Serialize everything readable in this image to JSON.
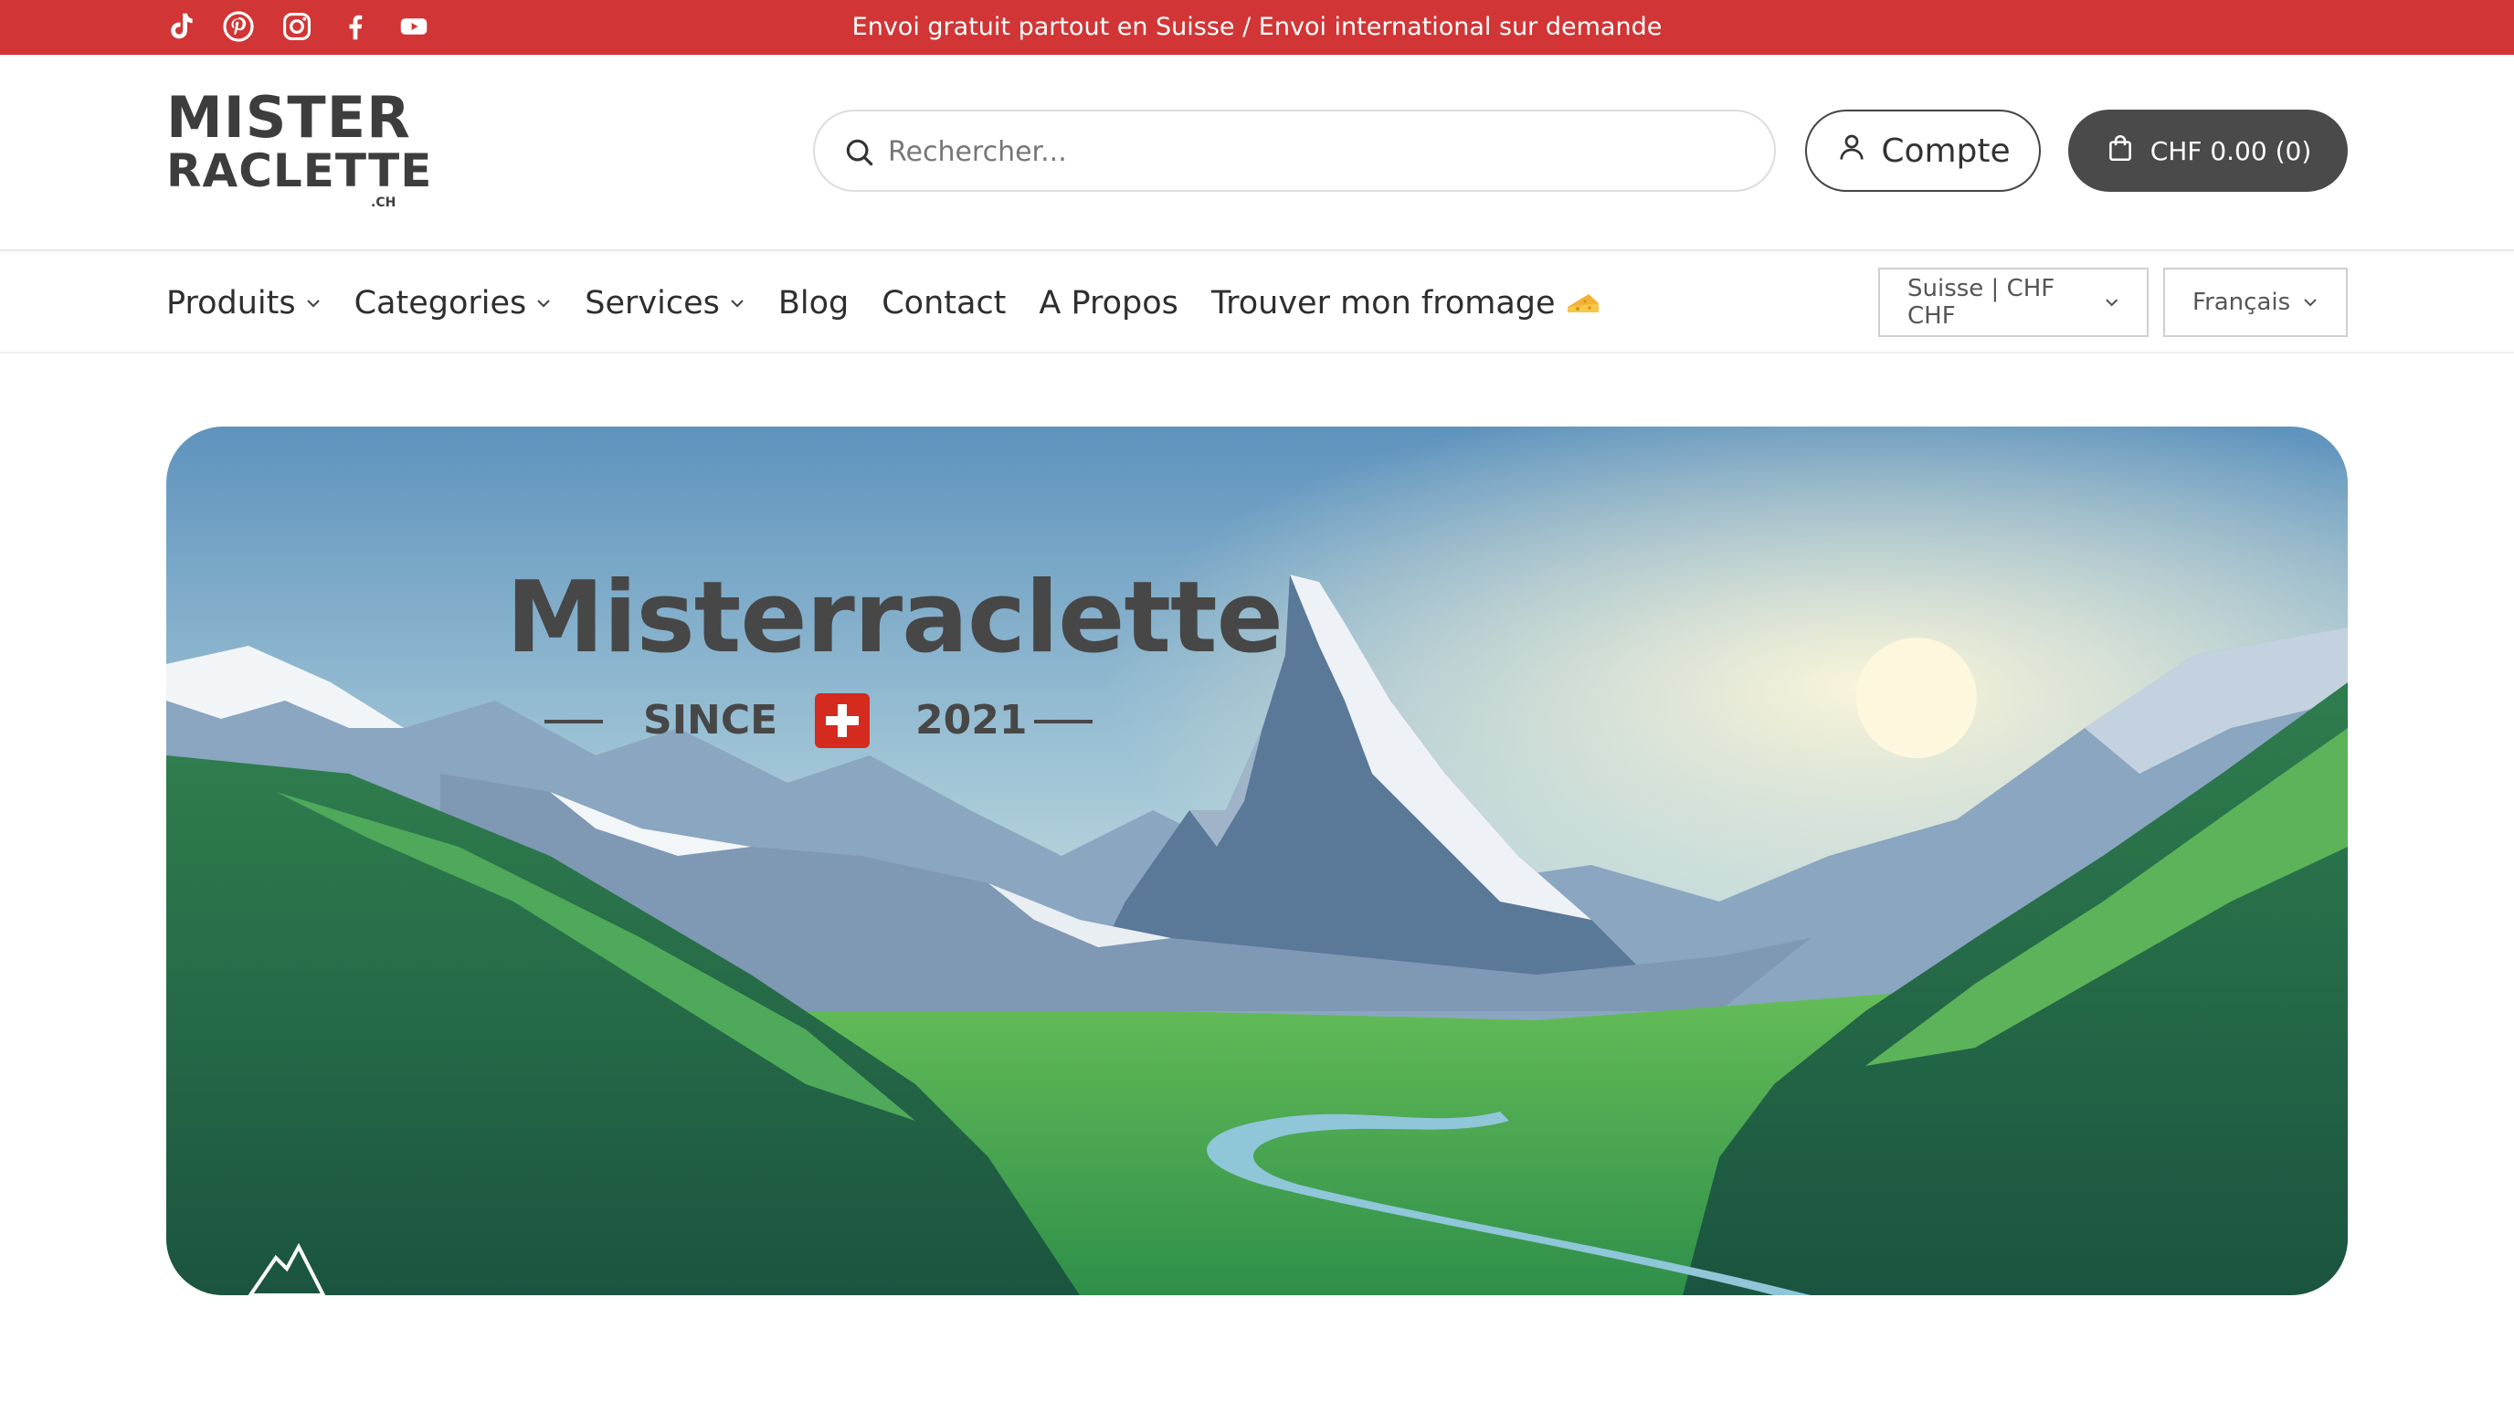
{
  "topbar": {
    "announcement": "Envoi gratuit partout en Suisse / Envoi international sur demande",
    "social": [
      "tiktok-icon",
      "pinterest-icon",
      "instagram-icon",
      "facebook-icon",
      "youtube-icon"
    ],
    "color": "#d13535"
  },
  "header": {
    "logo": {
      "line1": "MISTER",
      "line2": "RACLETTE",
      "suffix": ".CH"
    },
    "search": {
      "placeholder": "Rechercher...",
      "value": ""
    },
    "account_label": "Compte",
    "cart_label": "CHF 0.00 (0)"
  },
  "nav": {
    "items": [
      {
        "label": "Produits",
        "dropdown": true
      },
      {
        "label": "Categories",
        "dropdown": true
      },
      {
        "label": "Services",
        "dropdown": true
      },
      {
        "label": "Blog",
        "dropdown": false
      },
      {
        "label": "Contact",
        "dropdown": false
      },
      {
        "label": "A Propos",
        "dropdown": false
      },
      {
        "label": "Trouver mon fromage",
        "dropdown": false,
        "icon": "cheese-icon"
      }
    ],
    "country_select": "Suisse | CHF CHF",
    "language_select": "Français"
  },
  "hero": {
    "title": "Misterraclette",
    "since_word": "SINCE",
    "year": "2021"
  }
}
